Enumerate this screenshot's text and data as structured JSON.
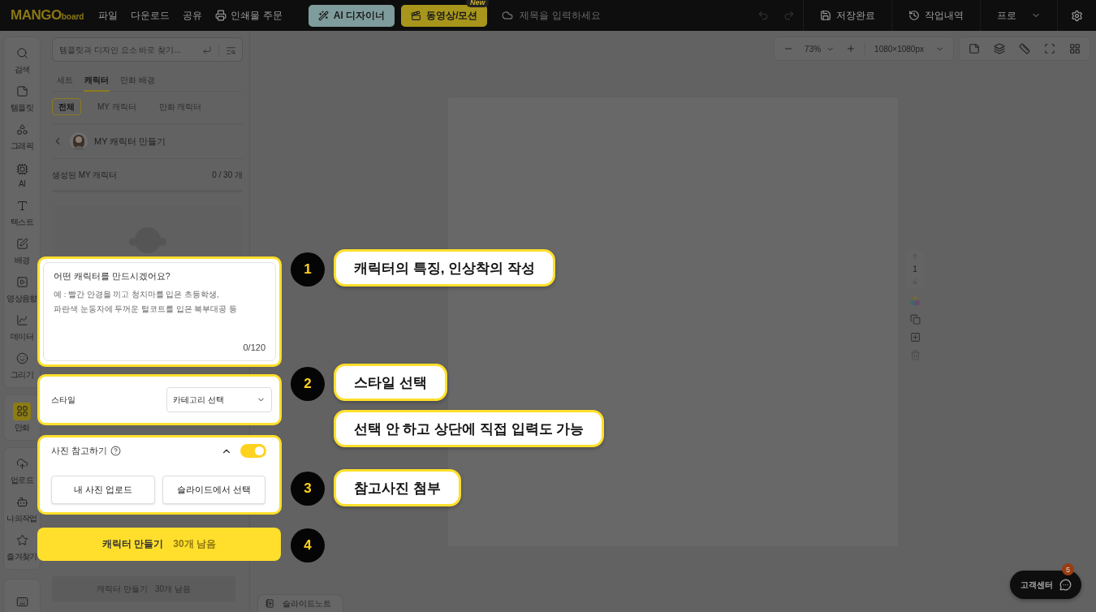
{
  "top_bar": {
    "logo_main": "MANGO",
    "logo_sub": "board",
    "menu": [
      "파일",
      "다운로드",
      "공유"
    ],
    "print_order": "인쇄물 주문",
    "ai_button": "AI 디자이너",
    "video_button": "동영상/모션",
    "new_badge": "New",
    "title_placeholder": "제목을 입력하세요",
    "save_status": "저장완료",
    "history": "작업내역",
    "plan": "프로"
  },
  "rail": {
    "groups": [
      {
        "items": [
          {
            "kind": "search",
            "label": "검색",
            "selected": false
          },
          {
            "kind": "template",
            "label": "템플릿",
            "selected": false
          },
          {
            "kind": "graphic",
            "label": "그래픽",
            "selected": false
          },
          {
            "kind": "ai",
            "label": "AI",
            "selected": false
          },
          {
            "kind": "text",
            "label": "텍스트",
            "selected": false
          },
          {
            "kind": "background",
            "label": "배경",
            "selected": false
          },
          {
            "kind": "video",
            "label": "영상음향",
            "selected": false
          },
          {
            "kind": "data",
            "label": "데이터",
            "selected": false
          },
          {
            "kind": "draw",
            "label": "그리기",
            "selected": false
          }
        ]
      },
      {
        "items": [
          {
            "kind": "comic",
            "label": "만화",
            "selected": true
          }
        ]
      },
      {
        "items": [
          {
            "kind": "upload",
            "label": "업로드",
            "selected": false
          },
          {
            "kind": "mywork",
            "label": "나의작업",
            "selected": false
          },
          {
            "kind": "favorite",
            "label": "즐겨찾기",
            "selected": false
          }
        ]
      },
      {
        "items": [
          {
            "kind": "toolbox",
            "selected": false
          }
        ]
      }
    ]
  },
  "panel": {
    "search_placeholder": "템플릿과 디자인 요소 바로 찾기...",
    "tabs": [
      {
        "label": "세트",
        "selected": false
      },
      {
        "label": "캐릭터",
        "selected": true
      },
      {
        "label": "만화 배경",
        "selected": false
      }
    ],
    "filters": [
      {
        "label": "전체",
        "selected": true
      },
      {
        "label": "MY 캐릭터",
        "selected": false
      },
      {
        "label": "만화 캐릭터",
        "selected": false
      }
    ],
    "back_title": "MY 캐릭터 만들기",
    "generated_label": "생성된 MY 캐릭터",
    "generated_count": "0 / 30 개",
    "level": 0,
    "bottom_button": {
      "label": "캐릭터 만들기",
      "remaining": "30개 남음",
      "disabled": true
    }
  },
  "canvas": {
    "zoom": "73%",
    "size": "1080×1080px",
    "page_number": "1",
    "slide_note": "슬라이드노트"
  },
  "help": {
    "label": "고객센터",
    "badge": "5"
  },
  "guide": {
    "prompt": {
      "title": "어떤 캐릭터를 만드시겠어요?",
      "placeholder": "예 : 빨간 안경을 끼고 청치마를 입은 초등학생,\n파란색 눈동자에 두꺼운 털코트를 입은 북부대공 등",
      "counter": "0/120"
    },
    "style": {
      "label": "스타일",
      "select": "카테고리 선택"
    },
    "photo_ref": {
      "label": "사진 참고하기",
      "on": true,
      "expanded": true,
      "buttons": [
        "내 사진 업로드",
        "슬라이드에서 선택"
      ]
    },
    "create_button": {
      "label": "캐릭터 만들기",
      "remaining": "30개 남음"
    },
    "steps": [
      {
        "number": "1",
        "callouts": [
          "캐릭터의 특징, 인상착의 작성"
        ]
      },
      {
        "number": "2",
        "callouts": [
          "스타일 선택",
          "선택 안 하고 상단에 직접 입력도 가능"
        ]
      },
      {
        "number": "3",
        "callouts": [
          "참고사진 첨부"
        ]
      },
      {
        "number": "4"
      }
    ]
  }
}
